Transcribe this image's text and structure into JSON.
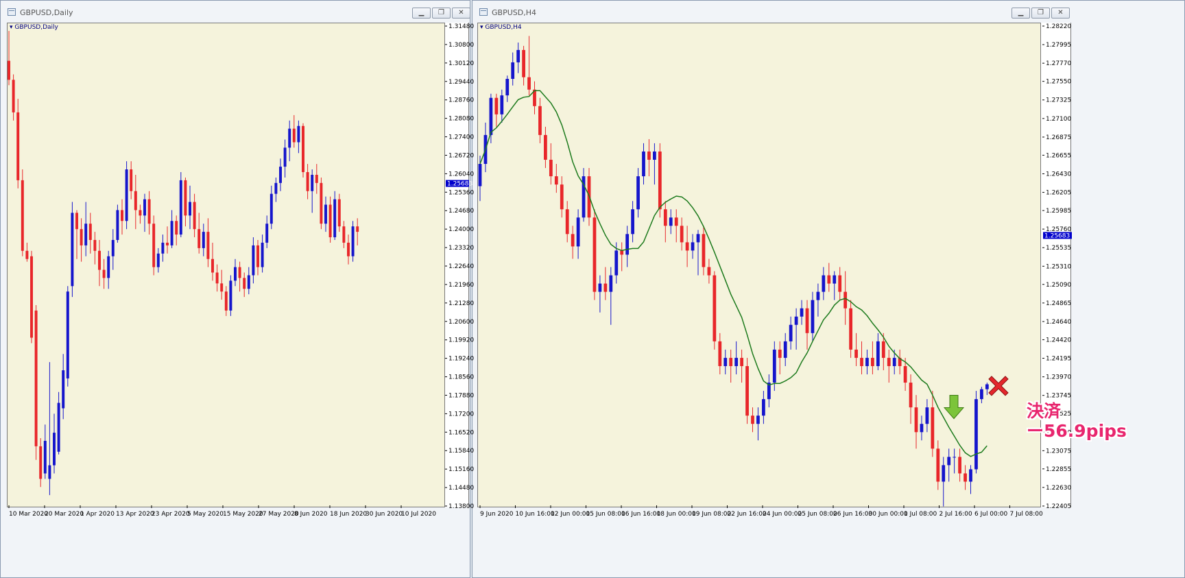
{
  "left_window": {
    "title": "GBPUSD,Daily",
    "chart_label": "GBPUSD,Daily",
    "price_tag": "1.25683",
    "buttons": {
      "minimize": "▁",
      "restore": "❐",
      "close": "✕"
    }
  },
  "right_window": {
    "title": "GBPUSD,H4",
    "chart_label": "GBPUSD,H4",
    "price_tag": "1.25683",
    "buttons": {
      "minimize": "▁",
      "restore": "❐",
      "close": "✕"
    }
  },
  "annotation": {
    "line1": "決済",
    "line2": "ー56.9pips",
    "close_marker_icon": "red-x-icon",
    "entry_marker_icon": "green-down-arrow-icon"
  },
  "colors": {
    "bull": "#1515cc",
    "bear": "#e8262a",
    "ma": "#1c7a1c",
    "plot_bg": "#f5f3dc",
    "annotation": "#e8256e"
  },
  "chart_data": [
    {
      "type": "candlestick",
      "symbol": "GBPUSD",
      "timeframe": "Daily",
      "ylim": [
        1.138,
        1.3148
      ],
      "y_ticks": [
        "1.31480",
        "1.30800",
        "1.30120",
        "1.29440",
        "1.28760",
        "1.28080",
        "1.27400",
        "1.26720",
        "1.26040",
        "1.25360",
        "1.24680",
        "1.24000",
        "1.23320",
        "1.22640",
        "1.21960",
        "1.21280",
        "1.20600",
        "1.19920",
        "1.19240",
        "1.18560",
        "1.17880",
        "1.17200",
        "1.16520",
        "1.15840",
        "1.15160",
        "1.14480",
        "1.13800"
      ],
      "x_ticks": [
        "10 Mar 2020",
        "20 Mar 2020",
        "1 Apr 2020",
        "13 Apr 2020",
        "23 Apr 2020",
        "5 May 2020",
        "15 May 2020",
        "27 May 2020",
        "8 Jun 2020",
        "18 Jun 2020",
        "30 Jun 2020",
        "10 Jul 2020"
      ],
      "last_price": 1.25683,
      "ohlc": [
        [
          1.302,
          1.313,
          1.293,
          1.295
        ],
        [
          1.295,
          1.297,
          1.28,
          1.283
        ],
        [
          1.283,
          1.288,
          1.255,
          1.258
        ],
        [
          1.258,
          1.262,
          1.23,
          1.232
        ],
        [
          1.232,
          1.235,
          1.228,
          1.229
        ],
        [
          1.23,
          1.232,
          1.198,
          1.2
        ],
        [
          1.21,
          1.212,
          1.155,
          1.16
        ],
        [
          1.16,
          1.163,
          1.145,
          1.148
        ],
        [
          1.15,
          1.168,
          1.148,
          1.162
        ],
        [
          1.148,
          1.191,
          1.142,
          1.153
        ],
        [
          1.153,
          1.172,
          1.15,
          1.165
        ],
        [
          1.158,
          1.18,
          1.157,
          1.176
        ],
        [
          1.174,
          1.194,
          1.17,
          1.188
        ],
        [
          1.185,
          1.219,
          1.182,
          1.217
        ],
        [
          1.219,
          1.25,
          1.215,
          1.246
        ],
        [
          1.246,
          1.247,
          1.229,
          1.24
        ],
        [
          1.24,
          1.244,
          1.228,
          1.234
        ],
        [
          1.234,
          1.25,
          1.23,
          1.242
        ],
        [
          1.242,
          1.246,
          1.231,
          1.236
        ],
        [
          1.236,
          1.239,
          1.227,
          1.232
        ],
        [
          1.232,
          1.236,
          1.219,
          1.225
        ],
        [
          1.225,
          1.229,
          1.218,
          1.222
        ],
        [
          1.222,
          1.232,
          1.218,
          1.23
        ],
        [
          1.23,
          1.24,
          1.225,
          1.236
        ],
        [
          1.236,
          1.249,
          1.235,
          1.247
        ],
        [
          1.247,
          1.251,
          1.238,
          1.243
        ],
        [
          1.243,
          1.265,
          1.24,
          1.262
        ],
        [
          1.262,
          1.265,
          1.251,
          1.254
        ],
        [
          1.254,
          1.26,
          1.24,
          1.247
        ],
        [
          1.247,
          1.249,
          1.242,
          1.245
        ],
        [
          1.245,
          1.253,
          1.239,
          1.251
        ],
        [
          1.251,
          1.254,
          1.238,
          1.242
        ],
        [
          1.242,
          1.245,
          1.223,
          1.226
        ],
        [
          1.226,
          1.233,
          1.224,
          1.231
        ],
        [
          1.231,
          1.238,
          1.228,
          1.235
        ],
        [
          1.235,
          1.241,
          1.231,
          1.234
        ],
        [
          1.234,
          1.247,
          1.233,
          1.243
        ],
        [
          1.243,
          1.245,
          1.234,
          1.238
        ],
        [
          1.238,
          1.261,
          1.237,
          1.258
        ],
        [
          1.258,
          1.259,
          1.241,
          1.245
        ],
        [
          1.245,
          1.256,
          1.24,
          1.25
        ],
        [
          1.25,
          1.253,
          1.237,
          1.24
        ],
        [
          1.24,
          1.246,
          1.231,
          1.233
        ],
        [
          1.233,
          1.242,
          1.23,
          1.239
        ],
        [
          1.239,
          1.244,
          1.226,
          1.229
        ],
        [
          1.229,
          1.235,
          1.221,
          1.224
        ],
        [
          1.224,
          1.227,
          1.217,
          1.22
        ],
        [
          1.22,
          1.225,
          1.214,
          1.217
        ],
        [
          1.217,
          1.219,
          1.208,
          1.21
        ],
        [
          1.21,
          1.223,
          1.208,
          1.221
        ],
        [
          1.221,
          1.229,
          1.219,
          1.226
        ],
        [
          1.226,
          1.228,
          1.217,
          1.222
        ],
        [
          1.222,
          1.224,
          1.215,
          1.218
        ],
        [
          1.218,
          1.226,
          1.216,
          1.223
        ],
        [
          1.223,
          1.237,
          1.22,
          1.234
        ],
        [
          1.234,
          1.236,
          1.223,
          1.226
        ],
        [
          1.226,
          1.238,
          1.224,
          1.235
        ],
        [
          1.235,
          1.245,
          1.233,
          1.242
        ],
        [
          1.242,
          1.256,
          1.24,
          1.253
        ],
        [
          1.253,
          1.259,
          1.25,
          1.257
        ],
        [
          1.257,
          1.266,
          1.254,
          1.263
        ],
        [
          1.263,
          1.273,
          1.259,
          1.27
        ],
        [
          1.27,
          1.28,
          1.265,
          1.277
        ],
        [
          1.277,
          1.282,
          1.27,
          1.272
        ],
        [
          1.272,
          1.28,
          1.268,
          1.278
        ],
        [
          1.278,
          1.279,
          1.259,
          1.261
        ],
        [
          1.261,
          1.264,
          1.251,
          1.254
        ],
        [
          1.254,
          1.262,
          1.246,
          1.26
        ],
        [
          1.26,
          1.264,
          1.253,
          1.257
        ],
        [
          1.257,
          1.259,
          1.24,
          1.242
        ],
        [
          1.242,
          1.252,
          1.239,
          1.249
        ],
        [
          1.249,
          1.252,
          1.235,
          1.237
        ],
        [
          1.237,
          1.254,
          1.236,
          1.251
        ],
        [
          1.251,
          1.253,
          1.239,
          1.241
        ],
        [
          1.241,
          1.243,
          1.233,
          1.235
        ],
        [
          1.235,
          1.238,
          1.227,
          1.23
        ],
        [
          1.23,
          1.243,
          1.228,
          1.241
        ],
        [
          1.241,
          1.244,
          1.234,
          1.239
        ]
      ]
    },
    {
      "type": "candlestick",
      "symbol": "GBPUSD",
      "timeframe": "H4",
      "ylim": [
        1.22405,
        1.2822
      ],
      "y_ticks": [
        "1.28220",
        "1.27995",
        "1.27770",
        "1.27550",
        "1.27325",
        "1.27100",
        "1.26875",
        "1.26655",
        "1.26430",
        "1.26205",
        "1.25985",
        "1.25760",
        "1.25535",
        "1.25310",
        "1.25090",
        "1.24865",
        "1.24640",
        "1.24420",
        "1.24195",
        "1.23970",
        "1.23745",
        "1.23525",
        "1.23300",
        "1.23075",
        "1.22855",
        "1.22630",
        "1.22405"
      ],
      "x_ticks": [
        "9 Jun 2020",
        "10 Jun 16:00",
        "12 Jun 00:00",
        "15 Jun 08:00",
        "16 Jun 16:00",
        "18 Jun 00:00",
        "19 Jun 08:00",
        "22 Jun 16:00",
        "24 Jun 00:00",
        "25 Jun 08:00",
        "26 Jun 16:00",
        "30 Jun 00:00",
        "1 Jul 08:00",
        "2 Jul 16:00",
        "6 Jul 00:00",
        "7 Jul 08:00"
      ],
      "last_price": 1.25683,
      "indicator": "moving_average",
      "ohlc": [
        [
          1.2628,
          1.2665,
          1.261,
          1.2655
        ],
        [
          1.2655,
          1.2705,
          1.2645,
          1.269
        ],
        [
          1.269,
          1.274,
          1.268,
          1.2735
        ],
        [
          1.2735,
          1.274,
          1.27,
          1.2715
        ],
        [
          1.2715,
          1.2745,
          1.2705,
          1.2738
        ],
        [
          1.2738,
          1.2762,
          1.273,
          1.2758
        ],
        [
          1.2758,
          1.279,
          1.275,
          1.2778
        ],
        [
          1.2778,
          1.2802,
          1.2765,
          1.2793
        ],
        [
          1.2793,
          1.2798,
          1.275,
          1.276
        ],
        [
          1.276,
          1.281,
          1.2738,
          1.2745
        ],
        [
          1.2745,
          1.2755,
          1.2715,
          1.2725
        ],
        [
          1.2725,
          1.2735,
          1.268,
          1.269
        ],
        [
          1.269,
          1.27,
          1.265,
          1.266
        ],
        [
          1.266,
          1.268,
          1.263,
          1.264
        ],
        [
          1.264,
          1.2655,
          1.262,
          1.263
        ],
        [
          1.263,
          1.264,
          1.259,
          1.26
        ],
        [
          1.26,
          1.261,
          1.256,
          1.257
        ],
        [
          1.257,
          1.258,
          1.254,
          1.2555
        ],
        [
          1.2555,
          1.26,
          1.254,
          1.259
        ],
        [
          1.259,
          1.265,
          1.2585,
          1.264
        ],
        [
          1.264,
          1.265,
          1.258,
          1.259
        ],
        [
          1.259,
          1.26,
          1.249,
          1.25
        ],
        [
          1.25,
          1.252,
          1.2475,
          1.251
        ],
        [
          1.251,
          1.253,
          1.249,
          1.25
        ],
        [
          1.25,
          1.253,
          1.246,
          1.252
        ],
        [
          1.252,
          1.256,
          1.251,
          1.255
        ],
        [
          1.255,
          1.256,
          1.2525,
          1.2545
        ],
        [
          1.2545,
          1.258,
          1.253,
          1.257
        ],
        [
          1.257,
          1.261,
          1.256,
          1.26
        ],
        [
          1.26,
          1.265,
          1.259,
          1.264
        ],
        [
          1.264,
          1.268,
          1.263,
          1.267
        ],
        [
          1.267,
          1.2685,
          1.264,
          1.266
        ],
        [
          1.266,
          1.268,
          1.263,
          1.267
        ],
        [
          1.267,
          1.268,
          1.259,
          1.26
        ],
        [
          1.26,
          1.261,
          1.256,
          1.258
        ],
        [
          1.258,
          1.26,
          1.257,
          1.259
        ],
        [
          1.259,
          1.26,
          1.256,
          1.258
        ],
        [
          1.258,
          1.259,
          1.255,
          1.256
        ],
        [
          1.256,
          1.258,
          1.253,
          1.255
        ],
        [
          1.255,
          1.257,
          1.254,
          1.256
        ],
        [
          1.256,
          1.2575,
          1.252,
          1.257
        ],
        [
          1.257,
          1.258,
          1.252,
          1.253
        ],
        [
          1.253,
          1.254,
          1.251,
          1.252
        ],
        [
          1.252,
          1.2525,
          1.243,
          1.244
        ],
        [
          1.244,
          1.245,
          1.24,
          1.241
        ],
        [
          1.241,
          1.243,
          1.24,
          1.242
        ],
        [
          1.242,
          1.243,
          1.239,
          1.241
        ],
        [
          1.241,
          1.244,
          1.24,
          1.242
        ],
        [
          1.242,
          1.243,
          1.239,
          1.241
        ],
        [
          1.241,
          1.242,
          1.234,
          1.235
        ],
        [
          1.235,
          1.236,
          1.233,
          1.234
        ],
        [
          1.234,
          1.236,
          1.232,
          1.235
        ],
        [
          1.235,
          1.238,
          1.234,
          1.237
        ],
        [
          1.237,
          1.24,
          1.236,
          1.239
        ],
        [
          1.239,
          1.244,
          1.238,
          1.243
        ],
        [
          1.243,
          1.244,
          1.24,
          1.242
        ],
        [
          1.242,
          1.245,
          1.241,
          1.244
        ],
        [
          1.244,
          1.247,
          1.243,
          1.246
        ],
        [
          1.246,
          1.248,
          1.243,
          1.247
        ],
        [
          1.247,
          1.249,
          1.246,
          1.248
        ],
        [
          1.248,
          1.249,
          1.243,
          1.245
        ],
        [
          1.245,
          1.25,
          1.244,
          1.249
        ],
        [
          1.249,
          1.251,
          1.247,
          1.25
        ],
        [
          1.25,
          1.253,
          1.249,
          1.252
        ],
        [
          1.252,
          1.2535,
          1.25,
          1.251
        ],
        [
          1.251,
          1.2525,
          1.249,
          1.252
        ],
        [
          1.252,
          1.253,
          1.249,
          1.25
        ],
        [
          1.25,
          1.2525,
          1.246,
          1.248
        ],
        [
          1.248,
          1.249,
          1.242,
          1.243
        ],
        [
          1.243,
          1.245,
          1.241,
          1.242
        ],
        [
          1.242,
          1.244,
          1.24,
          1.241
        ],
        [
          1.241,
          1.243,
          1.24,
          1.242
        ],
        [
          1.242,
          1.244,
          1.24,
          1.241
        ],
        [
          1.241,
          1.245,
          1.2405,
          1.244
        ],
        [
          1.244,
          1.245,
          1.2405,
          1.242
        ],
        [
          1.242,
          1.243,
          1.239,
          1.241
        ],
        [
          1.241,
          1.243,
          1.24,
          1.242
        ],
        [
          1.242,
          1.243,
          1.24,
          1.241
        ],
        [
          1.241,
          1.242,
          1.238,
          1.239
        ],
        [
          1.239,
          1.24,
          1.234,
          1.236
        ],
        [
          1.236,
          1.2375,
          1.231,
          1.233
        ],
        [
          1.233,
          1.235,
          1.232,
          1.234
        ],
        [
          1.234,
          1.237,
          1.233,
          1.236
        ],
        [
          1.236,
          1.238,
          1.23,
          1.231
        ],
        [
          1.231,
          1.232,
          1.226,
          1.227
        ],
        [
          1.227,
          1.23,
          1.224,
          1.229
        ],
        [
          1.229,
          1.231,
          1.227,
          1.23
        ],
        [
          1.23,
          1.231,
          1.228,
          1.23
        ],
        [
          1.23,
          1.231,
          1.227,
          1.228
        ],
        [
          1.228,
          1.229,
          1.226,
          1.227
        ],
        [
          1.227,
          1.229,
          1.2255,
          1.2285
        ],
        [
          1.2285,
          1.238,
          1.228,
          1.237
        ],
        [
          1.237,
          1.2385,
          1.2365,
          1.2382
        ],
        [
          1.2382,
          1.239,
          1.2375,
          1.2388
        ]
      ]
    }
  ]
}
